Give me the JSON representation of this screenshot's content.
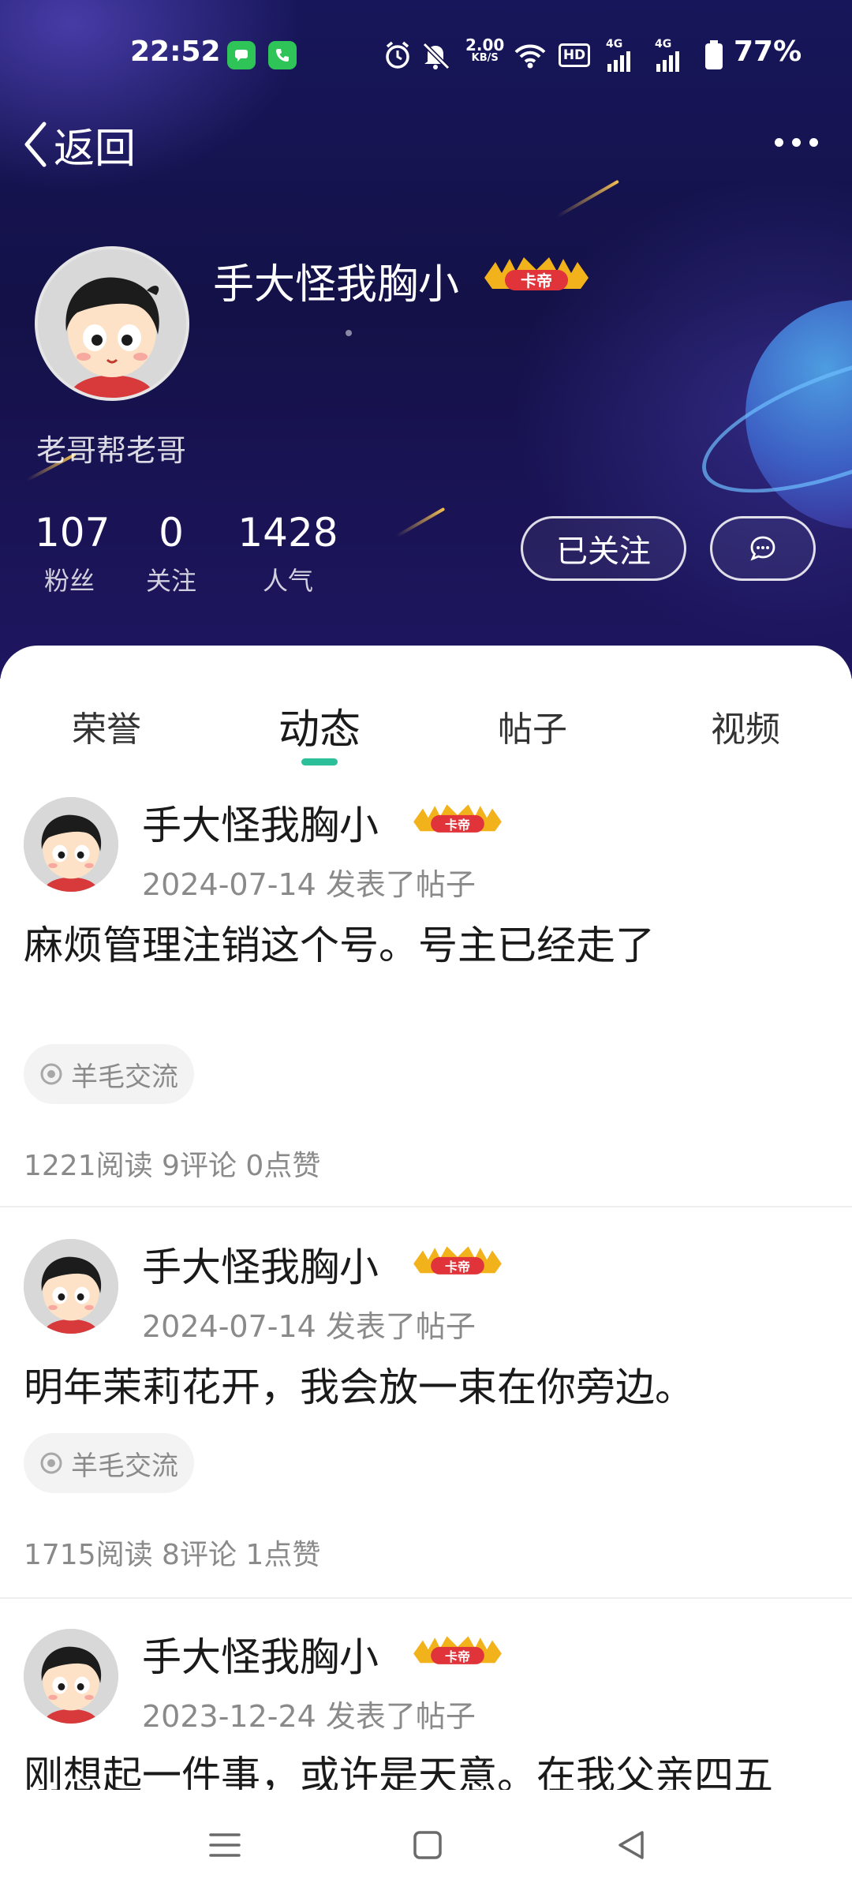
{
  "status_bar": {
    "time": "22:52",
    "net_speed": "2.00",
    "net_speed_unit": "KB/S",
    "hd_label": "HD",
    "net1": "4G",
    "net2": "4G",
    "battery": "77%"
  },
  "nav": {
    "back_label": "返回"
  },
  "profile": {
    "name": "手大怪我胸小",
    "badge": "卡帝",
    "bio": "老哥帮老哥",
    "stats": [
      {
        "value": "107",
        "label": "粉丝"
      },
      {
        "value": "0",
        "label": "关注"
      },
      {
        "value": "1428",
        "label": "人气"
      }
    ],
    "follow_label": "已关注"
  },
  "tabs": [
    {
      "label": "荣誉",
      "active": false
    },
    {
      "label": "动态",
      "active": true
    },
    {
      "label": "帖子",
      "active": false
    },
    {
      "label": "视频",
      "active": false
    }
  ],
  "posts": [
    {
      "author": "手大怪我胸小",
      "badge": "卡帝",
      "meta": "2024-07-14 发表了帖子",
      "text": "麻烦管理注销这个号。号主已经走了",
      "tag": "羊毛交流",
      "stats": "1221阅读 9评论 0点赞"
    },
    {
      "author": "手大怪我胸小",
      "badge": "卡帝",
      "meta": "2024-07-14 发表了帖子",
      "text": "明年茉莉花开，我会放一束在你旁边。",
      "tag": "羊毛交流",
      "stats": "1715阅读 8评论 1点赞"
    },
    {
      "author": "手大怪我胸小",
      "badge": "卡帝",
      "meta": "2023-12-24 发表了帖子",
      "text": "刚想起一件事，或许是天意。在我父亲四五"
    }
  ],
  "colors": {
    "accent": "#2bbf9a",
    "header_bg": "#17165a",
    "badge_red": "#e0343a",
    "badge_gold": "#f2b21c"
  }
}
